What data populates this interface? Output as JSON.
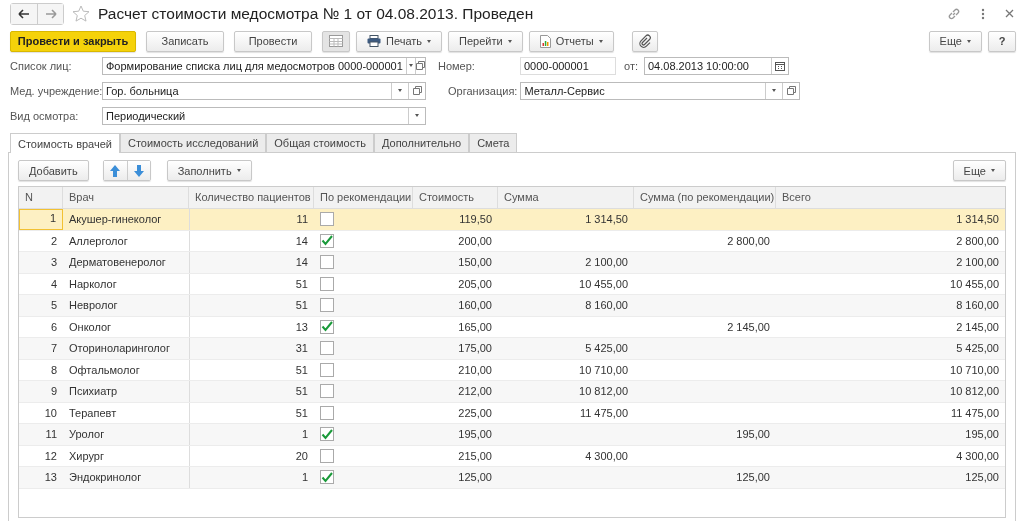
{
  "window": {
    "title": "Расчет стоимости медосмотра № 1 от 04.08.2013. Проведен"
  },
  "toolbar": {
    "post_close": "Провести и закрыть",
    "save": "Записать",
    "post": "Провести",
    "print": "Печать",
    "go_to": "Перейти",
    "reports": "Отчеты",
    "more": "Еще",
    "help": "?"
  },
  "fields": {
    "persons_list": {
      "label": "Список лиц:",
      "value": "Формирование списка лиц для медосмотров 0000-000001"
    },
    "number": {
      "label": "Номер:",
      "value": "0000-000001"
    },
    "date": {
      "label": "от:",
      "value": "04.08.2013 10:00:00"
    },
    "med_institution": {
      "label": "Мед. учреждение:",
      "value": "Гор. больница"
    },
    "organization": {
      "label": "Организация:",
      "value": "Металл-Сервис"
    },
    "exam_type": {
      "label": "Вид осмотра:",
      "value": "Периодический"
    }
  },
  "tabs": [
    {
      "label": "Стоимость врачей",
      "selected": true
    },
    {
      "label": "Стоимость исследований",
      "selected": false
    },
    {
      "label": "Общая стоимость",
      "selected": false
    },
    {
      "label": "Дополнительно",
      "selected": false
    },
    {
      "label": "Смета",
      "selected": false
    }
  ],
  "table_toolbar": {
    "add": "Добавить",
    "fill": "Заполнить",
    "more": "Еще"
  },
  "table": {
    "columns": [
      "N",
      "Врач",
      "Количество пациентов",
      "По рекомендации",
      "Стоимость",
      "Сумма",
      "Сумма (по рекомендации)",
      "Всего"
    ],
    "rows": [
      {
        "n": "1",
        "doctor": "Акушер-гинеколог",
        "patients": "11",
        "by_recommendation": false,
        "cost": "119,50",
        "sum": "1 314,50",
        "total": "1 314,50",
        "selected": true
      },
      {
        "n": "2",
        "doctor": "Аллерголог",
        "patients": "14",
        "by_recommendation": true,
        "cost": "200,00",
        "sum_rec": "2 800,00",
        "total": "2 800,00",
        "selected": false
      },
      {
        "n": "3",
        "doctor": "Дерматовенеролог",
        "patients": "14",
        "by_recommendation": false,
        "cost": "150,00",
        "sum": "2 100,00",
        "total": "2 100,00",
        "selected": false
      },
      {
        "n": "4",
        "doctor": "Нарколог",
        "patients": "51",
        "by_recommendation": false,
        "cost": "205,00",
        "sum": "10 455,00",
        "total": "10 455,00",
        "selected": false
      },
      {
        "n": "5",
        "doctor": "Невролог",
        "patients": "51",
        "by_recommendation": false,
        "cost": "160,00",
        "sum": "8 160,00",
        "total": "8 160,00",
        "selected": false
      },
      {
        "n": "6",
        "doctor": "Онколог",
        "patients": "13",
        "by_recommendation": true,
        "cost": "165,00",
        "sum_rec": "2 145,00",
        "total": "2 145,00",
        "selected": false
      },
      {
        "n": "7",
        "doctor": "Оториноларинголог",
        "patients": "31",
        "by_recommendation": false,
        "cost": "175,00",
        "sum": "5 425,00",
        "total": "5 425,00",
        "selected": false
      },
      {
        "n": "8",
        "doctor": "Офтальмолог",
        "patients": "51",
        "by_recommendation": false,
        "cost": "210,00",
        "sum": "10 710,00",
        "total": "10 710,00",
        "selected": false
      },
      {
        "n": "9",
        "doctor": "Психиатр",
        "patients": "51",
        "by_recommendation": false,
        "cost": "212,00",
        "sum": "10 812,00",
        "total": "10 812,00",
        "selected": false
      },
      {
        "n": "10",
        "doctor": "Терапевт",
        "patients": "51",
        "by_recommendation": false,
        "cost": "225,00",
        "sum": "11 475,00",
        "total": "11 475,00",
        "selected": false
      },
      {
        "n": "11",
        "doctor": "Уролог",
        "patients": "1",
        "by_recommendation": true,
        "cost": "195,00",
        "sum_rec": "195,00",
        "total": "195,00",
        "selected": false
      },
      {
        "n": "12",
        "doctor": "Хирург",
        "patients": "20",
        "by_recommendation": false,
        "cost": "215,00",
        "sum": "4 300,00",
        "total": "4 300,00",
        "selected": false
      },
      {
        "n": "13",
        "doctor": "Эндокринолог",
        "patients": "1",
        "by_recommendation": true,
        "cost": "125,00",
        "sum_rec": "125,00",
        "total": "125,00",
        "selected": false
      }
    ]
  }
}
